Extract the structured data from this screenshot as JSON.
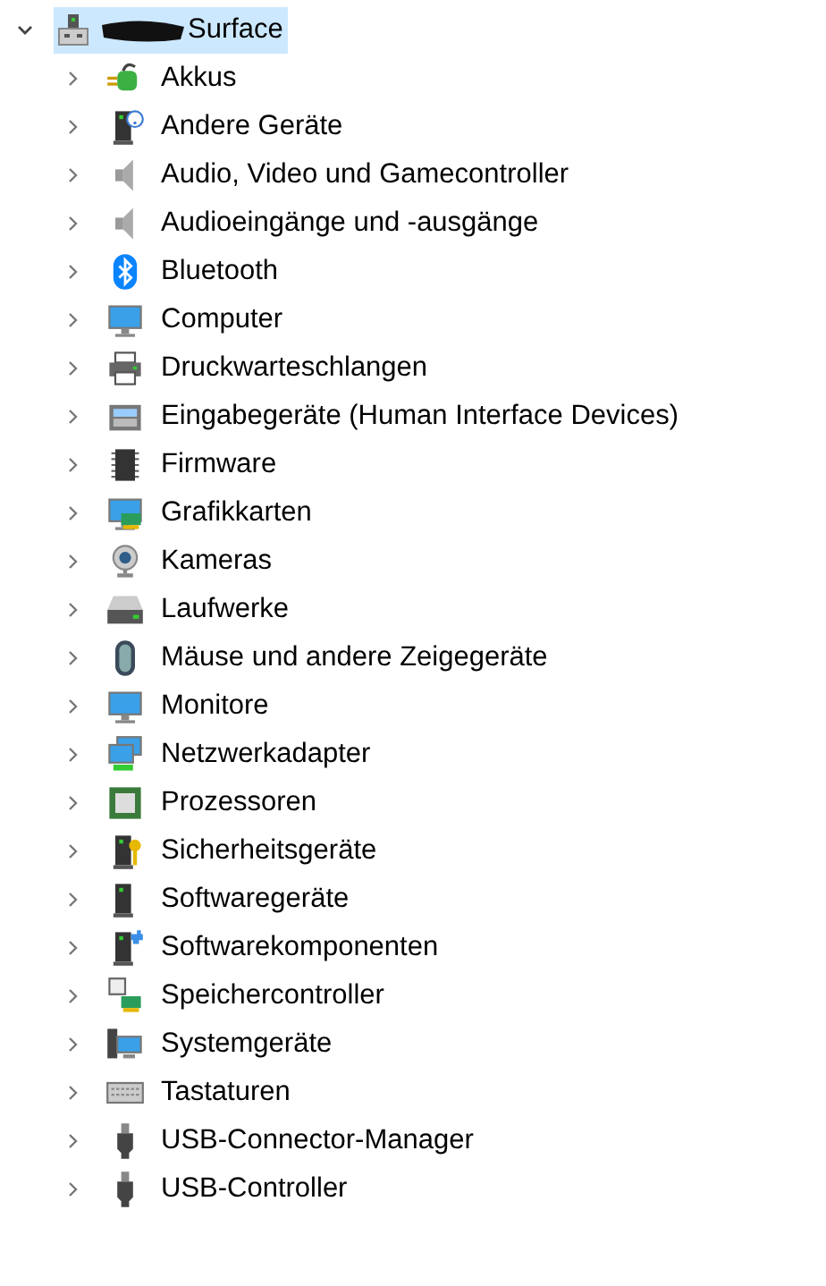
{
  "tree": {
    "label": "Surface",
    "expanded": true,
    "selected": true,
    "children": [
      {
        "label": "Akkus",
        "expanded": false
      },
      {
        "label": "Andere Geräte",
        "expanded": false
      },
      {
        "label": "Audio, Video und Gamecontroller",
        "expanded": false
      },
      {
        "label": "Audioeingänge und -ausgänge",
        "expanded": false
      },
      {
        "label": "Bluetooth",
        "expanded": false
      },
      {
        "label": "Computer",
        "expanded": false
      },
      {
        "label": "Druckwarteschlangen",
        "expanded": false
      },
      {
        "label": "Eingabegeräte (Human Interface Devices)",
        "expanded": false
      },
      {
        "label": "Firmware",
        "expanded": false
      },
      {
        "label": "Grafikkarten",
        "expanded": false
      },
      {
        "label": "Kameras",
        "expanded": false
      },
      {
        "label": "Laufwerke",
        "expanded": false
      },
      {
        "label": "Mäuse und andere Zeigegeräte",
        "expanded": false
      },
      {
        "label": "Monitore",
        "expanded": false
      },
      {
        "label": "Netzwerkadapter",
        "expanded": false
      },
      {
        "label": "Prozessoren",
        "expanded": false
      },
      {
        "label": "Sicherheitsgeräte",
        "expanded": false
      },
      {
        "label": "Softwaregeräte",
        "expanded": false
      },
      {
        "label": "Softwarekomponenten",
        "expanded": false
      },
      {
        "label": "Speichercontroller",
        "expanded": false
      },
      {
        "label": "Systemgeräte",
        "expanded": false
      },
      {
        "label": "Tastaturen",
        "expanded": false
      },
      {
        "label": "USB-Connector-Manager",
        "expanded": false
      },
      {
        "label": "USB-Controller",
        "expanded": false
      }
    ]
  }
}
